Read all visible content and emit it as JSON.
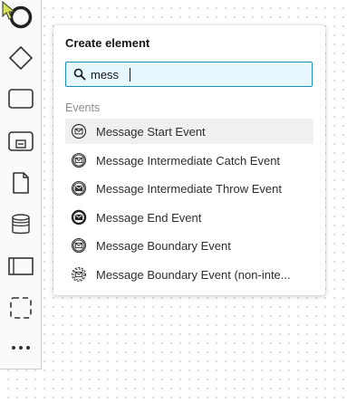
{
  "popup": {
    "title": "Create element",
    "search": {
      "value": "mess",
      "placeholder": ""
    },
    "group_label": "Events",
    "entries": [
      {
        "label": "Message Start Event",
        "icon": "message-start-event-icon"
      },
      {
        "label": "Message Intermediate Catch Event",
        "icon": "message-intermediate-catch-event-icon"
      },
      {
        "label": "Message Intermediate Throw Event",
        "icon": "message-intermediate-throw-event-icon"
      },
      {
        "label": "Message End Event",
        "icon": "message-end-event-icon"
      },
      {
        "label": "Message Boundary Event",
        "icon": "message-boundary-event-icon"
      },
      {
        "label": "Message Boundary Event (non-inte...",
        "icon": "message-boundary-event-non-interrupting-icon"
      }
    ]
  },
  "palette": {
    "tools": [
      "start-event-icon",
      "gateway-icon",
      "task-icon",
      "subprocess-icon",
      "data-object-icon",
      "data-store-icon",
      "pool-icon",
      "group-icon",
      "more-icon"
    ]
  },
  "colors": {
    "accent_border": "#1c8fb8",
    "search_background": "#e6f7fd",
    "selected_background": "#f0f0f0"
  }
}
